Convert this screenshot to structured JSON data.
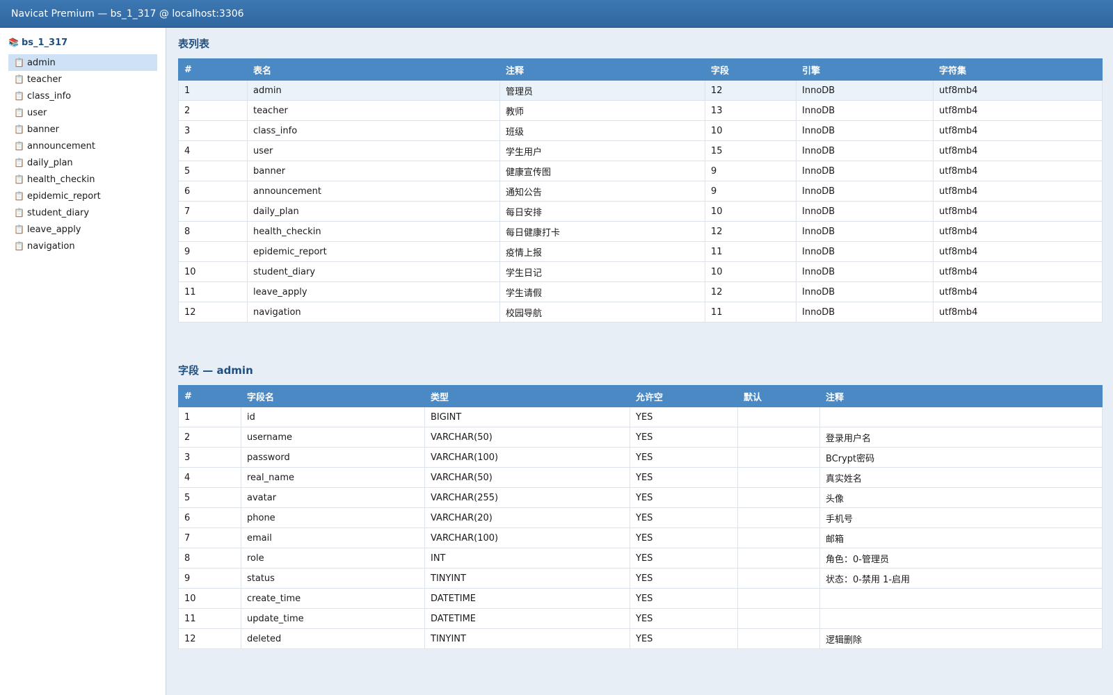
{
  "window": {
    "title": "Navicat Premium — bs_1_317 @ localhost:3306"
  },
  "sidebar": {
    "database": "bs_1_317",
    "database_icon": "books-icon",
    "item_icon": "clipboard-icon",
    "selected": "admin",
    "items": [
      {
        "label": "admin"
      },
      {
        "label": "teacher"
      },
      {
        "label": "class_info"
      },
      {
        "label": "user"
      },
      {
        "label": "banner"
      },
      {
        "label": "announcement"
      },
      {
        "label": "daily_plan"
      },
      {
        "label": "health_checkin"
      },
      {
        "label": "epidemic_report"
      },
      {
        "label": "student_diary"
      },
      {
        "label": "leave_apply"
      },
      {
        "label": "navigation"
      }
    ]
  },
  "tables_section": {
    "title": "表列表",
    "columns": [
      "#",
      "表名",
      "注释",
      "字段",
      "引擎",
      "字符集"
    ],
    "rows": [
      [
        "1",
        "admin",
        "管理员",
        "12",
        "InnoDB",
        "utf8mb4"
      ],
      [
        "2",
        "teacher",
        "教师",
        "13",
        "InnoDB",
        "utf8mb4"
      ],
      [
        "3",
        "class_info",
        "班级",
        "10",
        "InnoDB",
        "utf8mb4"
      ],
      [
        "4",
        "user",
        "学生用户",
        "15",
        "InnoDB",
        "utf8mb4"
      ],
      [
        "5",
        "banner",
        "健康宣传图",
        "9",
        "InnoDB",
        "utf8mb4"
      ],
      [
        "6",
        "announcement",
        "通知公告",
        "9",
        "InnoDB",
        "utf8mb4"
      ],
      [
        "7",
        "daily_plan",
        "每日安排",
        "10",
        "InnoDB",
        "utf8mb4"
      ],
      [
        "8",
        "health_checkin",
        "每日健康打卡",
        "12",
        "InnoDB",
        "utf8mb4"
      ],
      [
        "9",
        "epidemic_report",
        "疫情上报",
        "11",
        "InnoDB",
        "utf8mb4"
      ],
      [
        "10",
        "student_diary",
        "学生日记",
        "10",
        "InnoDB",
        "utf8mb4"
      ],
      [
        "11",
        "leave_apply",
        "学生请假",
        "12",
        "InnoDB",
        "utf8mb4"
      ],
      [
        "12",
        "navigation",
        "校园导航",
        "11",
        "InnoDB",
        "utf8mb4"
      ]
    ]
  },
  "fields_section": {
    "title": "字段 — admin",
    "columns": [
      "#",
      "字段名",
      "类型",
      "允许空",
      "默认",
      "注释"
    ],
    "rows": [
      [
        "1",
        "id",
        "BIGINT",
        "YES",
        "",
        ""
      ],
      [
        "2",
        "username",
        "VARCHAR(50)",
        "YES",
        "",
        "登录用户名"
      ],
      [
        "3",
        "password",
        "VARCHAR(100)",
        "YES",
        "",
        "BCrypt密码"
      ],
      [
        "4",
        "real_name",
        "VARCHAR(50)",
        "YES",
        "",
        "真实姓名"
      ],
      [
        "5",
        "avatar",
        "VARCHAR(255)",
        "YES",
        "",
        "头像"
      ],
      [
        "6",
        "phone",
        "VARCHAR(20)",
        "YES",
        "",
        "手机号"
      ],
      [
        "7",
        "email",
        "VARCHAR(100)",
        "YES",
        "",
        "邮箱"
      ],
      [
        "8",
        "role",
        "INT",
        "YES",
        "",
        "角色：0-管理员"
      ],
      [
        "9",
        "status",
        "TINYINT",
        "YES",
        "",
        "状态：0-禁用 1-启用"
      ],
      [
        "10",
        "create_time",
        "DATETIME",
        "YES",
        "",
        ""
      ],
      [
        "11",
        "update_time",
        "DATETIME",
        "YES",
        "",
        ""
      ],
      [
        "12",
        "deleted",
        "TINYINT",
        "YES",
        "",
        "逻辑删除"
      ]
    ]
  },
  "colors": {
    "titlebar": "#3d78b2",
    "header": "#4a89c4",
    "selected": "#cfe2f5",
    "accent_text": "#1f4f82",
    "background": "#e8eef5"
  }
}
